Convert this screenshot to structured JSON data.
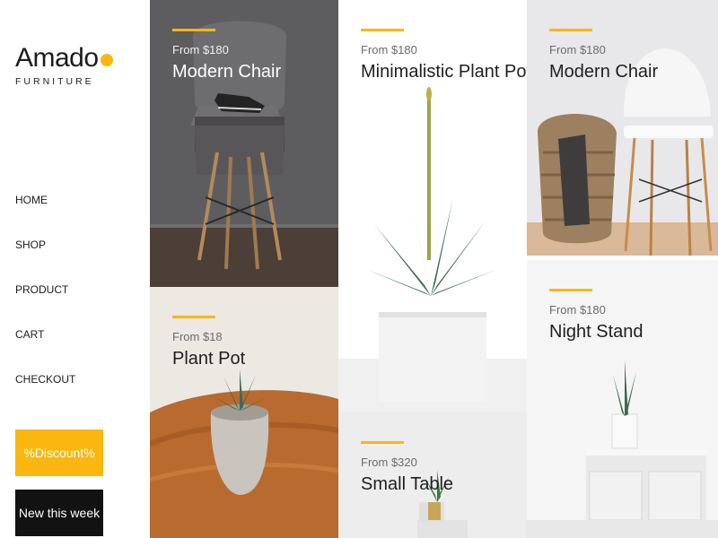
{
  "brand": {
    "name": "Amado",
    "tagline": "FURNITURE"
  },
  "nav": {
    "items": [
      "Home",
      "Shop",
      "Product",
      "Cart",
      "Checkout"
    ]
  },
  "buttons": {
    "discount": "%Discount%",
    "new_week": "New this week"
  },
  "colors": {
    "accent": "#fbb710",
    "dark_button": "#131212"
  },
  "products": [
    {
      "price": "From $180",
      "name": "Modern Chair"
    },
    {
      "price": "From $18",
      "name": "Plant Pot"
    },
    {
      "price": "From $180",
      "name": "Minimalistic Plant Pot"
    },
    {
      "price": "From $320",
      "name": "Small Table"
    },
    {
      "price": "From $180",
      "name": "Modern Chair"
    },
    {
      "price": "From $180",
      "name": "Night Stand"
    }
  ]
}
